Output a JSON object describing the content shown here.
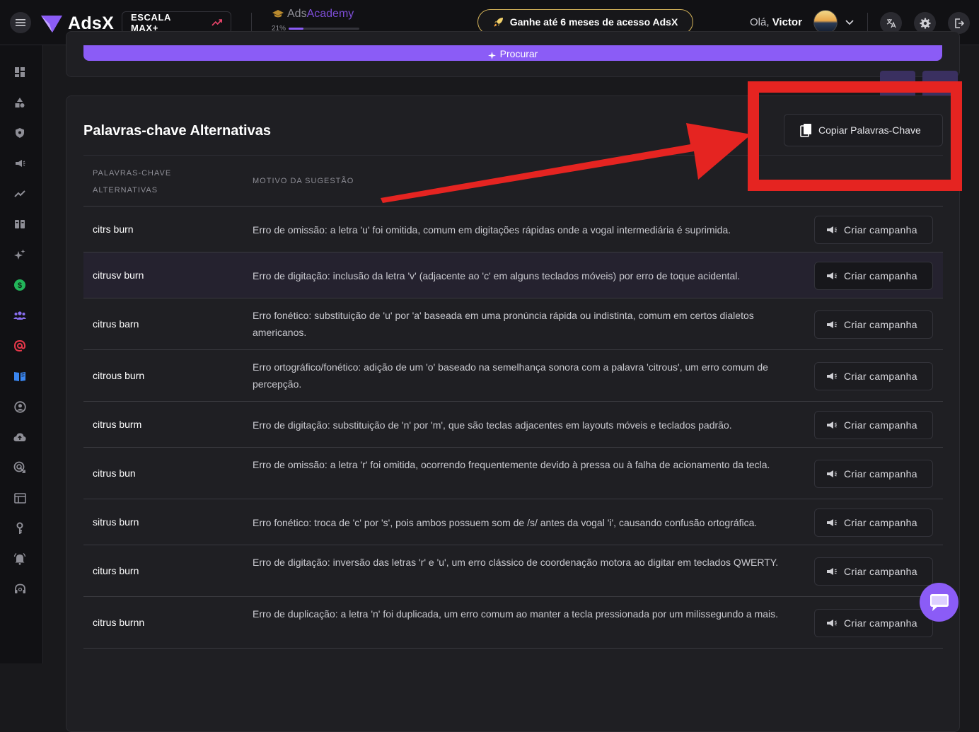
{
  "header": {
    "logo_text": "AdsX",
    "plan_label": "ESCALA MAX+",
    "academy_prefix": "Ads",
    "academy_suffix": "Academy",
    "academy_progress_label": "21%",
    "academy_progress_value": 0.21,
    "promo_text": "Ganhe até 6 meses de acesso AdsX",
    "greeting_prefix": "Olá,",
    "user_name": "Victor"
  },
  "search": {
    "button_label": "Procurar"
  },
  "section": {
    "title": "Palavras-chave Alternativas",
    "copy_button_label": "Copiar Palavras-Chave",
    "columns": [
      "PALAVRAS-CHAVE ALTERNATIVAS",
      "MOTIVO DA SUGESTÃO"
    ],
    "action_label": "Criar campanha",
    "rows": [
      {
        "keyword": "citrs burn",
        "reason": "Erro de omissão: a letra 'u' foi omitida, comum em digitações rápidas onde a vogal intermediária é suprimida."
      },
      {
        "keyword": "citrusv burn",
        "reason": "Erro de digitação: inclusão da letra 'v' (adjacente ao 'c' em alguns teclados móveis) por erro de toque acidental."
      },
      {
        "keyword": "citrus barn",
        "reason": "Erro fonético: substituição de 'u' por 'a' baseada em uma pronúncia rápida ou indistinta, comum em certos dialetos americanos."
      },
      {
        "keyword": "citrous burn",
        "reason": "Erro ortográfico/fonético: adição de um 'o' baseado na semelhança sonora com a palavra 'citrous', um erro comum de percepção."
      },
      {
        "keyword": "citrus burm",
        "reason": "Erro de digitação: substituição de 'n' por 'm', que são teclas adjacentes em layouts móveis e teclados padrão."
      },
      {
        "keyword": "citrus bun",
        "reason": "Erro de omissão: a letra 'r' foi omitida, ocorrendo frequentemente devido à pressa ou à falha de acionamento da tecla."
      },
      {
        "keyword": "sitrus burn",
        "reason": "Erro fonético: troca de 'c' por 's', pois ambos possuem som de /s/ antes da vogal 'i', causando confusão ortográfica."
      },
      {
        "keyword": "citurs burn",
        "reason": "Erro de digitação: inversão das letras 'r' e 'u', um erro clássico de coordenação motora ao digitar em teclados QWERTY."
      },
      {
        "keyword": "citrus burnn",
        "reason": "Erro de duplicação: a letra 'n' foi duplicada, um erro comum ao manter a tecla pressionada por um milissegundo a mais."
      }
    ]
  },
  "colors": {
    "accent": "#8b5cf6",
    "annotation": "#e52421",
    "background": "#19191c",
    "card": "#1f1f23"
  },
  "sidebar_icons": [
    "dashboard-icon",
    "shapes-icon",
    "shield-icon",
    "megaphone-icon",
    "trend-icon",
    "columns-icon",
    "sparkle-icon",
    "dollar-icon",
    "users-icon",
    "at-icon",
    "book-icon",
    "user-circle-icon",
    "cloud-upload-icon",
    "target-icon",
    "table-icon",
    "key-icon",
    "bell-icon",
    "headset-icon"
  ]
}
